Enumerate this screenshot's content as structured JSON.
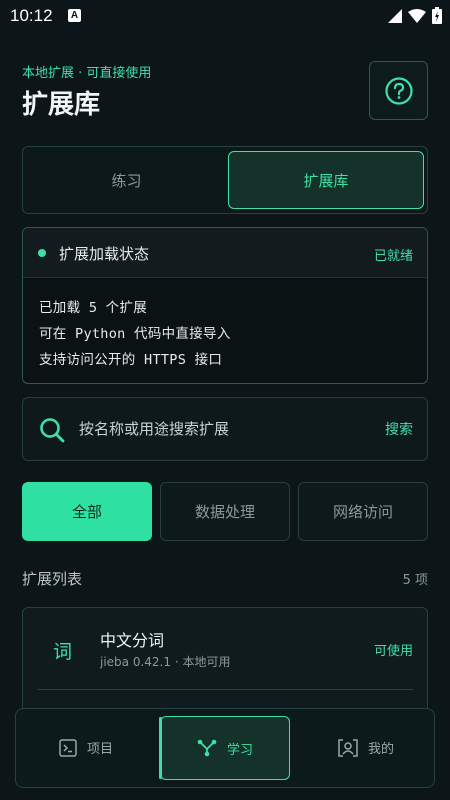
{
  "status_bar": {
    "time": "10:12",
    "notification_badge": "A"
  },
  "header": {
    "subtitle": "本地扩展 · 可直接使用",
    "title": "扩展库",
    "help_icon": "question-circle-icon"
  },
  "tabs": [
    {
      "label": "练习",
      "selected": false
    },
    {
      "label": "扩展库",
      "selected": true
    }
  ],
  "status_card": {
    "title": "扩展加载状态",
    "badge": "已就绪",
    "lines": [
      "已加载 5 个扩展",
      "可在 Python 代码中直接导入",
      "支持访问公开的 HTTPS 接口"
    ]
  },
  "search": {
    "placeholder": "按名称或用途搜索扩展",
    "button": "搜索"
  },
  "filters": [
    {
      "label": "全部",
      "selected": true
    },
    {
      "label": "数据处理",
      "selected": false
    },
    {
      "label": "网络访问",
      "selected": false
    }
  ],
  "list": {
    "title": "扩展列表",
    "count": "5 项",
    "items": [
      {
        "icon_char": "词",
        "name": "中文分词",
        "meta": "jieba 0.42.1 · 本地可用",
        "status": "可使用"
      }
    ]
  },
  "bottom_nav": [
    {
      "label": "项目",
      "icon": "terminal-icon",
      "selected": false
    },
    {
      "label": "学习",
      "icon": "branch-icon",
      "selected": true
    },
    {
      "label": "我的",
      "icon": "profile-icon",
      "selected": false
    }
  ],
  "colors": {
    "accent": "#3fe0a8",
    "background": "#0c1518",
    "surface": "#0f1b1d"
  }
}
